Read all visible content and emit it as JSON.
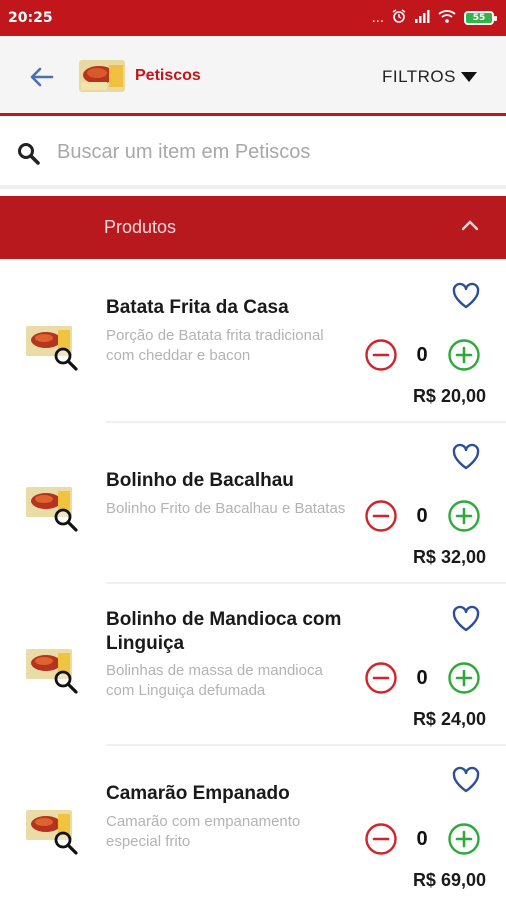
{
  "status_bar": {
    "time": "20:25",
    "dots": "...",
    "battery": "55"
  },
  "header": {
    "category": "Petiscos",
    "filters_label": "FILTROS"
  },
  "search": {
    "placeholder": "Buscar um item em Petiscos"
  },
  "section": {
    "title": "Produtos"
  },
  "colors": {
    "brand_red": "#c0161c",
    "minus_red": "#d0242b",
    "plus_green": "#2eaa3a",
    "heart_blue": "#2a4f9c"
  },
  "products": [
    {
      "name": "Batata Frita da Casa",
      "description": "Porção de Batata frita tradicional com cheddar e bacon",
      "quantity": "0",
      "price": "R$ 20,00"
    },
    {
      "name": "Bolinho de Bacalhau",
      "description": "Bolinho Frito de Bacalhau e Batatas",
      "quantity": "0",
      "price": "R$ 32,00"
    },
    {
      "name": "Bolinho de Mandioca com Linguiça",
      "description": "Bolinhas de massa de mandioca com Linguiça defumada",
      "quantity": "0",
      "price": "R$ 24,00"
    },
    {
      "name": "Camarão Empanado",
      "description": "Camarão com empanamento especial frito",
      "quantity": "0",
      "price": "R$ 69,00"
    }
  ]
}
